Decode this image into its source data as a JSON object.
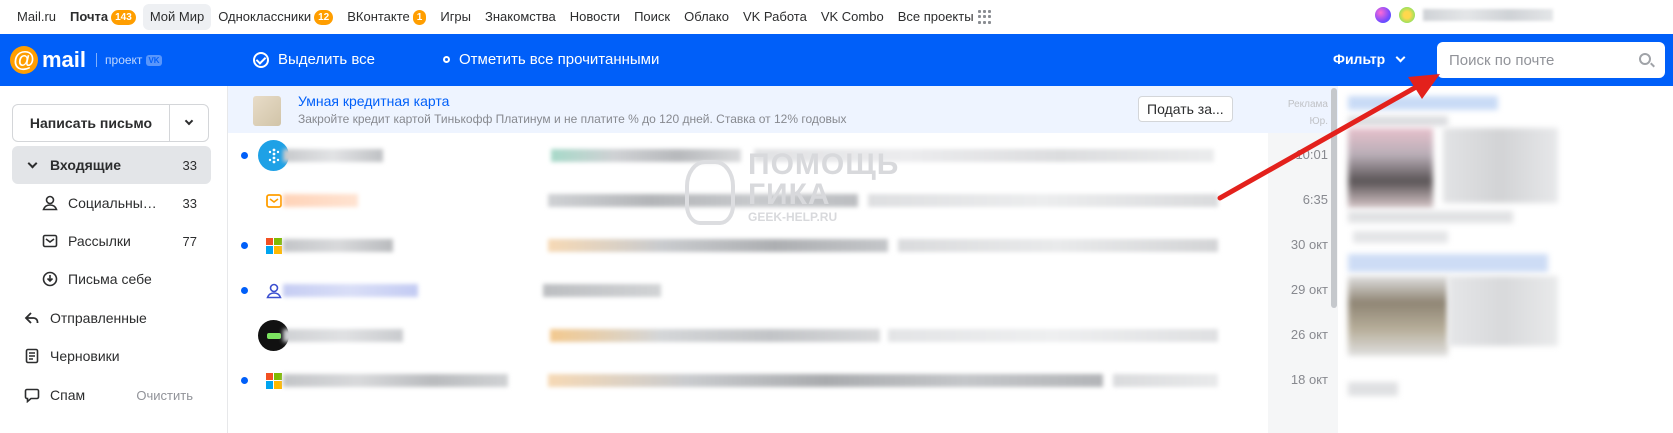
{
  "portal": {
    "links": [
      {
        "label": "Mail.ru",
        "bold": false,
        "active": false
      },
      {
        "label": "Почта",
        "bold": true,
        "active": false,
        "badge": "143"
      },
      {
        "label": "Мой Мир",
        "bold": false,
        "active": true
      },
      {
        "label": "Одноклассники",
        "bold": false,
        "active": false,
        "badge": "12"
      },
      {
        "label": "ВКонтакте",
        "bold": false,
        "active": false,
        "badge": "1"
      },
      {
        "label": "Игры"
      },
      {
        "label": "Знакомства"
      },
      {
        "label": "Новости"
      },
      {
        "label": "Поиск"
      },
      {
        "label": "Облако"
      },
      {
        "label": "VK Работа"
      },
      {
        "label": "VK Combo"
      },
      {
        "label": "Все проекты"
      }
    ]
  },
  "header": {
    "logo_at": "@",
    "logo_word": "mail",
    "logo_project": "проект",
    "logo_vk": "VK",
    "select_all": "Выделить все",
    "mark_all_read": "Отметить все прочитанными",
    "filter": "Фильтр",
    "search_placeholder": "Поиск по почте",
    "brand_color": "#005ff9"
  },
  "sidebar": {
    "compose": "Написать письмо",
    "folders": [
      {
        "label": "Входящие",
        "count": "33",
        "active": true,
        "icon": "chevron-down-icon"
      },
      {
        "label": "Социальны…",
        "count": "33",
        "sub": true,
        "icon": "people-icon"
      },
      {
        "label": "Рассылки",
        "count": "77",
        "sub": true,
        "icon": "newsletter-icon"
      },
      {
        "label": "Письма себе",
        "count": "",
        "sub": true,
        "icon": "inbox-download-icon"
      },
      {
        "label": "Отправленные",
        "count": "",
        "icon": "sent-icon"
      },
      {
        "label": "Черновики",
        "count": "",
        "icon": "draft-icon"
      },
      {
        "label": "Спам",
        "count": "",
        "action": "Очистить",
        "icon": "spam-icon"
      }
    ]
  },
  "ad": {
    "title": "Умная кредитная карта",
    "description": "Закройте кредит картой Тинькофф Платинум и не платите % до 120 дней. Ставка от 12% годовых",
    "button": "Подать за...",
    "tag_line1": "Реклама",
    "tag_line2": "Юр. информация"
  },
  "messages": [
    {
      "date": "10:01",
      "unread": true,
      "icon": "bank-app-icon"
    },
    {
      "date": "6:35",
      "unread": false,
      "icon": "orange-mail-icon"
    },
    {
      "date": "30 окт",
      "unread": true,
      "icon": "microsoft-icon"
    },
    {
      "date": "29 окт",
      "unread": true,
      "icon": "social-icon"
    },
    {
      "date": "26 окт",
      "unread": false,
      "icon": "geek-avatar-icon"
    },
    {
      "date": "18 окт",
      "unread": true,
      "icon": "microsoft-icon"
    }
  ],
  "watermark": {
    "line1": "ПОМОЩЬ",
    "line2": "ГИКА",
    "line3": "GEEK-HELP.RU"
  }
}
